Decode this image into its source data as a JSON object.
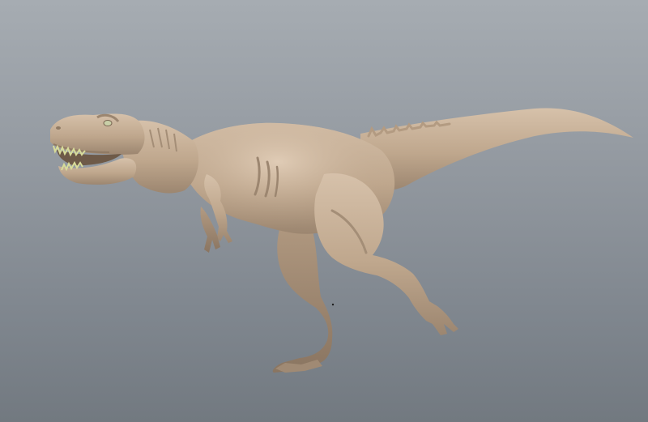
{
  "viewport": {
    "background_top": "#a6acb2",
    "background_bottom": "#727980"
  },
  "model": {
    "subject": "tyrannosaurus-sculpt",
    "skin_color": "#c2ab92",
    "shadow_color": "#8f7a64",
    "highlight_color": "#ddc9b3",
    "teeth_color": "#d8dc9a"
  }
}
